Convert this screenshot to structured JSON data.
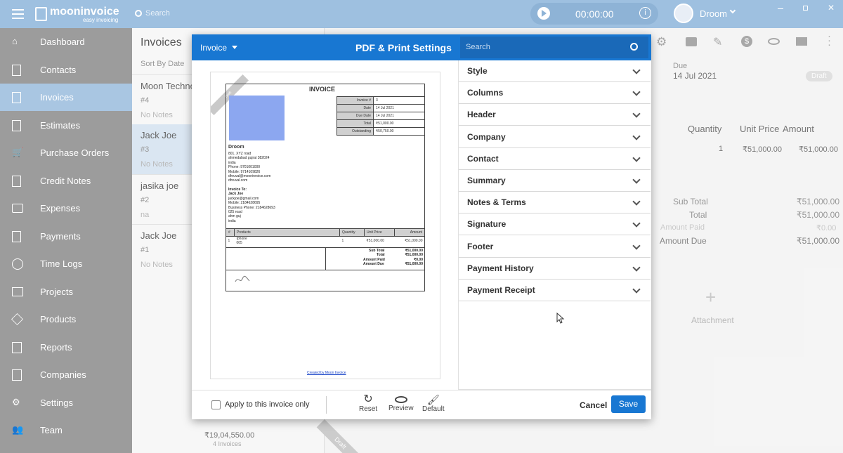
{
  "topbar": {
    "brand": "mooninvoice",
    "tagline": "easy invoicing",
    "search_placeholder": "Search",
    "timer": "00:00:00",
    "user": "Droom"
  },
  "sidebar": {
    "items": [
      "Dashboard",
      "Contacts",
      "Invoices",
      "Estimates",
      "Purchase Orders",
      "Credit Notes",
      "Expenses",
      "Payments",
      "Time Logs",
      "Projects",
      "Products",
      "Reports",
      "Companies",
      "Settings",
      "Team"
    ]
  },
  "list": {
    "title": "Invoices",
    "sort": "Sort By Date",
    "items": [
      {
        "name": "Moon Techno",
        "num": "#4",
        "note": "No Notes"
      },
      {
        "name": "Jack Joe",
        "num": "#3",
        "note": "No Notes"
      },
      {
        "name": "jasika joe",
        "num": "#2",
        "note": "na"
      },
      {
        "name": "Jack Joe",
        "num": "#1",
        "note": "No Notes"
      }
    ],
    "total": "₹19,04,550.00",
    "count": "4 Invoices"
  },
  "main": {
    "due_label": "Due",
    "due_date": "14 Jul 2021",
    "status": "Draft",
    "col_qty": "Quantity",
    "col_price": "Unit Price",
    "col_amount": "Amount",
    "row_qty": "1",
    "row_price": "₹51,000.00",
    "row_amount": "₹51,000.00",
    "summary": [
      {
        "label": "Sub Total",
        "value": "₹51,000.00"
      },
      {
        "label": "Total",
        "value": "₹51,000.00"
      },
      {
        "label": "Amount Paid",
        "value": "₹0.00"
      },
      {
        "label": "Amount Due",
        "value": "₹51,000.00"
      }
    ],
    "attachment": "Attachment",
    "draft_ribbon": "Draft"
  },
  "modal": {
    "doc_type": "Invoice",
    "title": "PDF & Print Settings",
    "search_placeholder": "Search",
    "sections": [
      "Style",
      "Columns",
      "Header",
      "Company",
      "Contact",
      "Summary",
      "Notes & Terms",
      "Signature",
      "Footer",
      "Payment History",
      "Payment Receipt"
    ],
    "apply_label": "Apply to this invoice only",
    "reset": "Reset",
    "preview": "Preview",
    "default": "Default",
    "cancel": "Cancel",
    "save": "Save"
  },
  "preview": {
    "ribbon": "Draft",
    "heading": "INVOICE",
    "meta": [
      {
        "k": "Invoice #",
        "v": "3"
      },
      {
        "k": "Date",
        "v": "14 Jul 2021"
      },
      {
        "k": "Due Date",
        "v": "14 Jul 2021"
      },
      {
        "k": "Total",
        "v": "₹51,000.00"
      },
      {
        "k": "Outstanding",
        "v": "₹50,750.00"
      }
    ],
    "company": "Droom",
    "company_lines": [
      "801, XYZ road",
      "ahmedabad gujrat 382024",
      "india",
      "Phone: 9701001000",
      "Mobile: 9714109826",
      "dhruval@mooninvoice.com",
      "dhruval.com"
    ],
    "to_label": "Invoice To:",
    "to_name": "Jack Joe",
    "to_lines": [
      "jackjoe@gmail.com",
      "Mobile: 2184628695",
      "Business Phone: 2184628693",
      "025 road",
      "ahm guj",
      "india"
    ],
    "cols": [
      "#",
      "Products",
      "Quantity",
      "Unit Price",
      "Amount"
    ],
    "row": [
      "1",
      "Iphone",
      "1",
      "₹51,000.00",
      "₹51,000.00"
    ],
    "row_sub": "005",
    "totals": [
      {
        "k": "Sub Total",
        "v": "₹51,000.00"
      },
      {
        "k": "Total",
        "v": "₹51,000.00"
      },
      {
        "k": "Amount Paid",
        "v": "₹0.00"
      },
      {
        "k": "Amount Due",
        "v": "₹51,000.00"
      }
    ],
    "footer_link": "Created by Moon Invoice"
  },
  "colors": {
    "brand_blue": "#1877d2",
    "sidebar": "#9c9c9c",
    "topbar": "#9ec0e0"
  }
}
